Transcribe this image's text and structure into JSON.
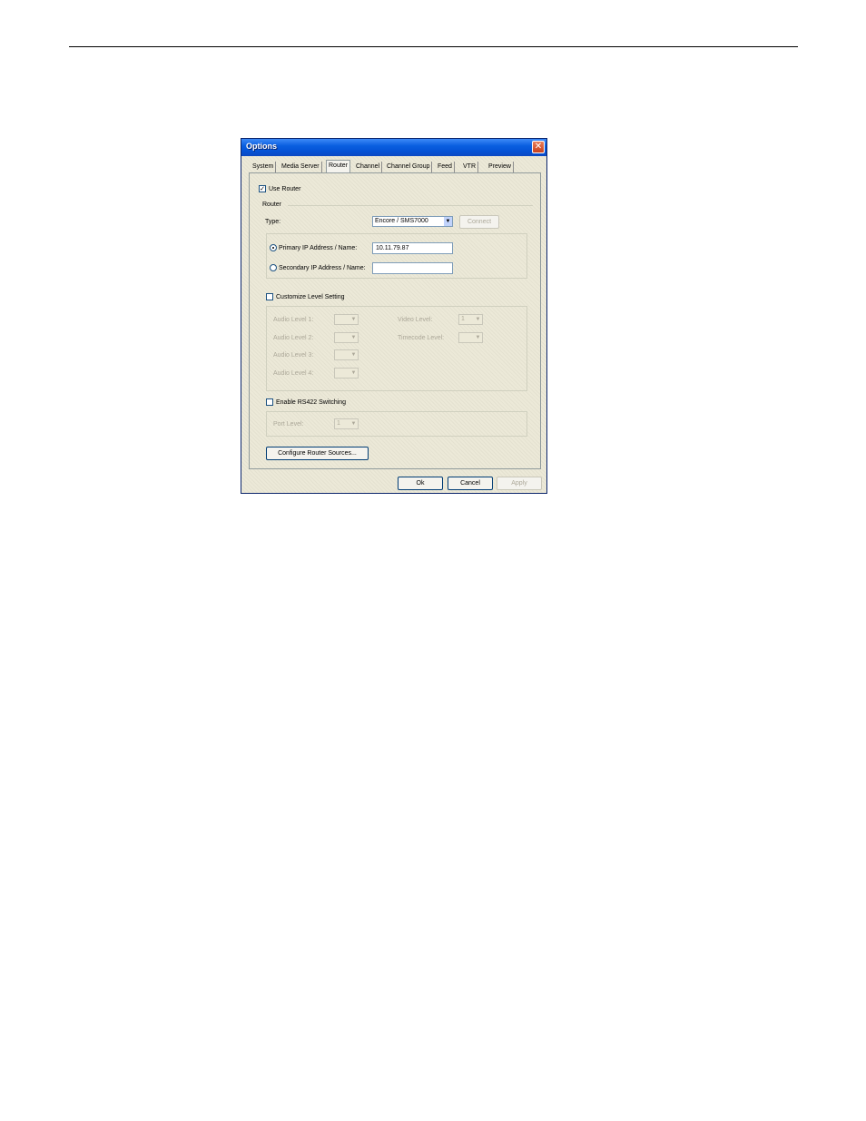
{
  "dialog": {
    "title": "Options",
    "close_glyph": "✕"
  },
  "tabs": [
    "System",
    "Media Server",
    "Router",
    "Channel",
    "Channel Group",
    "Feed",
    "VTR",
    "Preview"
  ],
  "use_router": {
    "label": "Use Router",
    "checked": true,
    "mark": "✓"
  },
  "router_group": {
    "label": "Router",
    "type_label": "Type:",
    "type_value": "Encore / SMS7000",
    "connect_label": "Connect",
    "primary_label": "Primary IP Address / Name:",
    "primary_value": "10.11.79.87",
    "secondary_label": "Secondary IP Address / Name:",
    "secondary_value": ""
  },
  "customize": {
    "label": "Customize Level Setting",
    "audio1": "Audio Level 1:",
    "audio2": "Audio Level 2:",
    "audio3": "Audio Level 3:",
    "audio4": "Audio Level 4:",
    "video": "Video Level:",
    "timecode": "Timecode Level:",
    "video_value": "1",
    "port_value": "1"
  },
  "rs422": {
    "label": "Enable RS422 Switching",
    "port_level": "Port Level:"
  },
  "buttons": {
    "configure": "Configure Router Sources...",
    "ok": "Ok",
    "cancel": "Cancel",
    "apply": "Apply"
  },
  "icons": {
    "dropdown": "▼"
  }
}
